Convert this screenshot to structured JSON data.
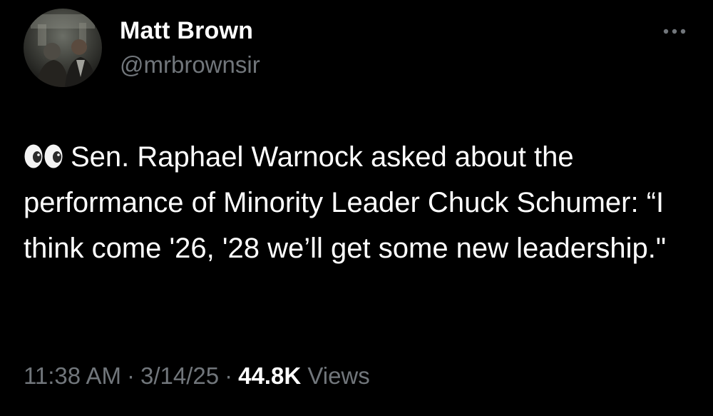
{
  "author": {
    "display_name": "Matt Brown",
    "handle": "@mrbrownsir"
  },
  "tweet": {
    "emoji_icon": "eyes-icon",
    "text": "Sen. Raphael Warnock asked about the performance of Minority Leader Chuck Schumer: “I think come '26, '28 we’ll get some new leadership.\""
  },
  "meta": {
    "time": "11:38 AM",
    "separator": "·",
    "date": "3/14/25",
    "views_count": "44.8K",
    "views_label": "Views"
  },
  "icons": {
    "more": "more-horizontal-icon"
  },
  "colors": {
    "background": "#000000",
    "primary_text": "#ffffff",
    "secondary_text": "#71767b"
  }
}
